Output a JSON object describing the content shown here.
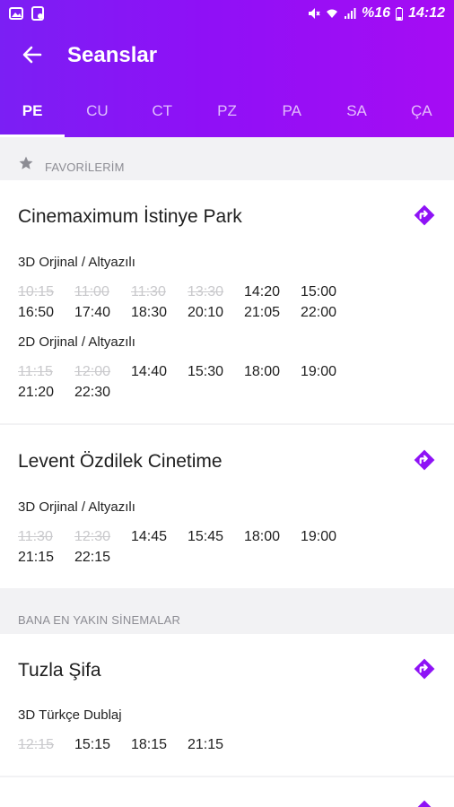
{
  "status_bar": {
    "battery": "%16",
    "time": "14:12"
  },
  "toolbar": {
    "title": "Seanslar"
  },
  "tabs": [
    "PE",
    "CU",
    "CT",
    "PZ",
    "PA",
    "SA",
    "ÇA"
  ],
  "colors": {
    "accent": "#8e12f6",
    "gradient_start": "#7b1ff4",
    "gradient_end": "#a60cf4",
    "past_time": "#c9c9cc"
  },
  "sections": {
    "favorites": "FAVORİLERİM",
    "nearby": "BANA EN YAKIN SİNEMALAR"
  },
  "favorites": [
    {
      "name": "Cinemaximum İstinye Park",
      "formats": [
        {
          "label": "3D Orjinal / Altyazılı",
          "times": [
            {
              "t": "10:15",
              "past": true
            },
            {
              "t": "11:00",
              "past": true
            },
            {
              "t": "11:30",
              "past": true
            },
            {
              "t": "13:30",
              "past": true
            },
            {
              "t": "14:20",
              "past": false
            },
            {
              "t": "15:00",
              "past": false
            },
            {
              "t": "16:50",
              "past": false
            },
            {
              "t": "17:40",
              "past": false
            },
            {
              "t": "18:30",
              "past": false
            },
            {
              "t": "20:10",
              "past": false
            },
            {
              "t": "21:05",
              "past": false
            },
            {
              "t": "22:00",
              "past": false
            }
          ]
        },
        {
          "label": "2D Orjinal / Altyazılı",
          "times": [
            {
              "t": "11:15",
              "past": true
            },
            {
              "t": "12:00",
              "past": true
            },
            {
              "t": "14:40",
              "past": false
            },
            {
              "t": "15:30",
              "past": false
            },
            {
              "t": "18:00",
              "past": false
            },
            {
              "t": "19:00",
              "past": false
            },
            {
              "t": "21:20",
              "past": false
            },
            {
              "t": "22:30",
              "past": false
            }
          ]
        }
      ]
    },
    {
      "name": "Levent Özdilek Cinetime",
      "formats": [
        {
          "label": "3D Orjinal / Altyazılı",
          "times": [
            {
              "t": "11:30",
              "past": true
            },
            {
              "t": "12:30",
              "past": true
            },
            {
              "t": "14:45",
              "past": false
            },
            {
              "t": "15:45",
              "past": false
            },
            {
              "t": "18:00",
              "past": false
            },
            {
              "t": "19:00",
              "past": false
            },
            {
              "t": "21:15",
              "past": false
            },
            {
              "t": "22:15",
              "past": false
            }
          ]
        }
      ]
    }
  ],
  "nearby": [
    {
      "name": "Tuzla Şifa",
      "formats": [
        {
          "label": "3D Türkçe Dublaj",
          "times": [
            {
              "t": "12:15",
              "past": true
            },
            {
              "t": "15:15",
              "past": false
            },
            {
              "t": "18:15",
              "past": false
            },
            {
              "t": "21:15",
              "past": false
            }
          ]
        }
      ]
    }
  ]
}
